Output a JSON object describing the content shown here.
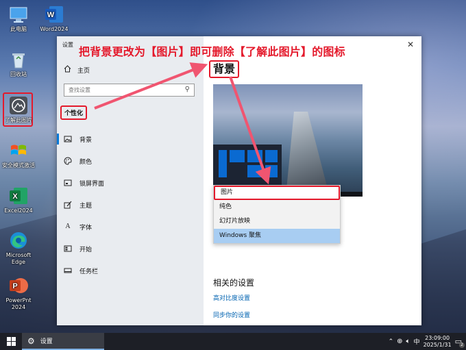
{
  "desktop": {
    "icons": [
      {
        "label": "此电脑",
        "icon": "computer-icon"
      },
      {
        "label": "Word2024",
        "icon": "word-icon"
      },
      {
        "label": "回收站",
        "icon": "recycle-bin-icon"
      },
      {
        "label": "了解此图片",
        "icon": "learn-about-picture-icon"
      },
      {
        "label": "安全模式激活",
        "icon": "windows-flag-icon"
      },
      {
        "label": "Excel2024",
        "icon": "excel-icon"
      },
      {
        "label": "Microsoft Edge",
        "icon": "edge-icon"
      },
      {
        "label": "PowerPnt 2024",
        "icon": "powerpoint-icon"
      }
    ]
  },
  "annotation": {
    "text": "把背景更改为【图片】即可删除【了解此图片】的图标"
  },
  "window": {
    "title": "设置",
    "close_glyph": "✕",
    "nav": {
      "home_label": "主页",
      "search_placeholder": "查找设置",
      "section_title": "个性化",
      "items": [
        {
          "label": "背景",
          "icon": "picture-icon",
          "active": true
        },
        {
          "label": "颜色",
          "icon": "palette-icon",
          "active": false
        },
        {
          "label": "锁屏界面",
          "icon": "lock-screen-icon",
          "active": false
        },
        {
          "label": "主题",
          "icon": "theme-icon",
          "active": false
        },
        {
          "label": "字体",
          "icon": "font-icon",
          "active": false
        },
        {
          "label": "开始",
          "icon": "start-icon",
          "active": false
        },
        {
          "label": "任务栏",
          "icon": "taskbar-icon",
          "active": false
        }
      ]
    },
    "main": {
      "page_title": "背景",
      "dropdown_options": [
        "图片",
        "纯色",
        "幻灯片放映",
        "Windows 聚焦"
      ],
      "dropdown_highlighted": "Windows 聚焦",
      "related_title": "相关的设置",
      "related_links": [
        "高对比度设置",
        "同步你的设置"
      ]
    }
  },
  "taskbar": {
    "app_label": "设置",
    "ime": "中",
    "time": "23:09:00",
    "date": "2025/1/31",
    "notification_count": "2"
  },
  "colors": {
    "annotation_red": "#e4192b",
    "accent_blue": "#0078d7",
    "link_blue": "#0063b1",
    "highlight": "#a8cdf2"
  }
}
